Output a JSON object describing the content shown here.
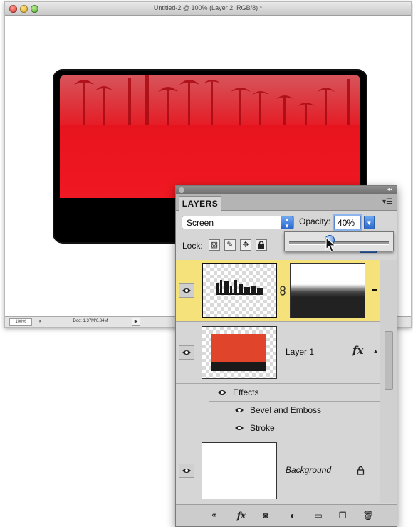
{
  "document": {
    "title": "Untitled-2 @ 100% (Layer 2, RGB/8) *",
    "zoom": "100%",
    "doc_size": "Doc: 1.37M/6.84M"
  },
  "layers_panel": {
    "tab": "LAYERS",
    "blend_mode": "Screen",
    "opacity_label": "Opacity:",
    "opacity_value": "40%",
    "opacity_fraction": 0.4,
    "lock_label": "Lock:",
    "layers": [
      {
        "name": ""
      },
      {
        "name": "Layer 1",
        "fx": "fx"
      },
      {
        "name": "Background"
      }
    ],
    "effects_label": "Effects",
    "effects": [
      "Bevel and Emboss",
      "Stroke"
    ]
  },
  "icons": {
    "eye": "eye-icon",
    "link": "chain-link-icon",
    "lock": "lock-icon",
    "fx": "fx-icon",
    "mask": "layer-mask-icon",
    "adjustment": "adjustment-layer-icon",
    "group": "folder-icon",
    "new": "new-layer-icon",
    "trash": "trash-icon"
  },
  "colors": {
    "banner_red": "#e8141e",
    "layer_selected": "#f5e27a",
    "accent_blue": "#2a69cf"
  }
}
